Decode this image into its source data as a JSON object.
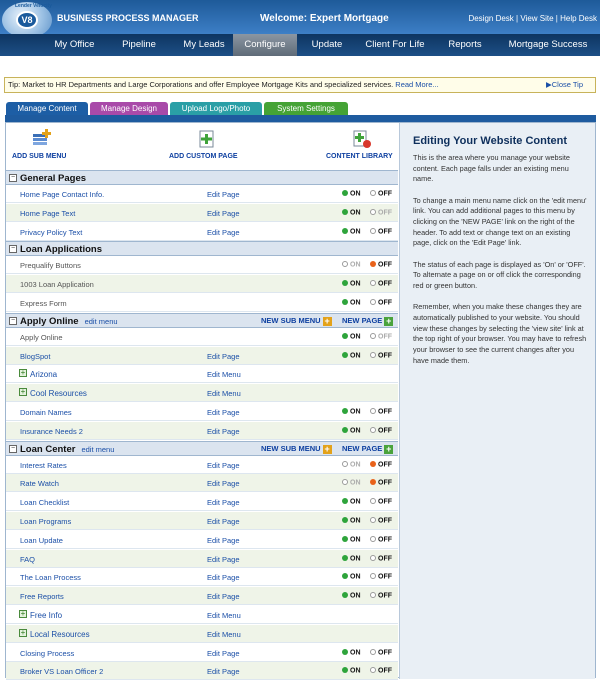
{
  "header": {
    "logo_text": "V8",
    "logo_small": "Lender Velocity",
    "app_title": "BUSINESS PROCESS MANAGER",
    "welcome": "Welcome: Expert Mortgage",
    "links": [
      "Design Desk",
      "View Site",
      "Help Desk"
    ],
    "sep": "|"
  },
  "nav": {
    "items": [
      "My Office",
      "Pipeline",
      "My Leads",
      "Configure",
      "Update",
      "Client For Life",
      "Reports",
      "Mortgage Success"
    ],
    "active": "Configure"
  },
  "tip": {
    "text": "Tip: Market to HR Departments and Large Corporations and offer Employee Mortgage Kits and specialized services.",
    "more": "Read More...",
    "close": "Close Tip",
    "close_arrow": "▶"
  },
  "tabs": [
    {
      "label": "Manage Content",
      "color": "#1d5ea5"
    },
    {
      "label": "Manage Design",
      "color": "#a94aa9"
    },
    {
      "label": "Upload Logo/Photo",
      "color": "#2a9fa6"
    },
    {
      "label": "System Settings",
      "color": "#45a335"
    }
  ],
  "toolbar": {
    "add_sub_menu": "ADD SUB MENU",
    "add_custom_page": "ADD CUSTOM PAGE",
    "content_library": "CONTENT LIBRARY"
  },
  "labels": {
    "edit_page": "Edit Page",
    "edit_menu": "Edit Menu",
    "edit_menu_header": "edit menu",
    "on": "ON",
    "off": "OFF",
    "new_sub_menu": "NEW SUB MENU",
    "new_page": "NEW PAGE",
    "minus": "−",
    "plus": "+"
  },
  "sections": [
    {
      "title": "General Pages",
      "rows": [
        {
          "name": "Home Page Contact Info.",
          "edit": "page",
          "state": "on"
        },
        {
          "name": "Home Page Text",
          "edit": "page",
          "state": "on",
          "muted_off": true
        },
        {
          "name": "Privacy Policy Text",
          "edit": "page",
          "state": "on"
        }
      ]
    },
    {
      "title": "Loan Applications",
      "rows": [
        {
          "name": "Prequalify Buttons",
          "state": "off",
          "gray": true
        },
        {
          "name": "1003 Loan Application",
          "state": "on",
          "gray": true
        },
        {
          "name": "Express Form",
          "state": "on",
          "gray": true
        }
      ]
    },
    {
      "title": "Apply Online",
      "editable": true,
      "rows": [
        {
          "name": "Apply Online",
          "state": "on",
          "gray": true,
          "muted_off": true
        },
        {
          "name": "BlogSpot",
          "edit": "page",
          "state": "on"
        },
        {
          "name": "Arizona",
          "edit": "menu",
          "sub": true
        },
        {
          "name": "Cool Resources",
          "edit": "menu",
          "sub": true
        },
        {
          "name": "Domain Names",
          "edit": "page",
          "state": "on"
        },
        {
          "name": "Insurance Needs 2",
          "edit": "page",
          "state": "on"
        }
      ]
    },
    {
      "title": "Loan Center",
      "editable": true,
      "rows": [
        {
          "name": "Interest Rates",
          "edit": "page",
          "state": "off"
        },
        {
          "name": "Rate Watch",
          "edit": "page",
          "state": "off"
        },
        {
          "name": "Loan Checklist",
          "edit": "page",
          "state": "on"
        },
        {
          "name": "Loan Programs",
          "edit": "page",
          "state": "on"
        },
        {
          "name": "Loan Update",
          "edit": "page",
          "state": "on"
        },
        {
          "name": "FAQ",
          "edit": "page",
          "state": "on"
        },
        {
          "name": "The Loan Process",
          "edit": "page",
          "state": "on"
        },
        {
          "name": "Free Reports",
          "edit": "page",
          "state": "on"
        },
        {
          "name": "Free Info",
          "edit": "menu",
          "sub": true
        },
        {
          "name": "Local Resources",
          "edit": "menu",
          "sub": true
        },
        {
          "name": "Closing Process",
          "edit": "page",
          "state": "on"
        },
        {
          "name": "Broker VS Loan Officer 2",
          "edit": "page",
          "state": "on"
        }
      ]
    }
  ],
  "help": {
    "title": "Editing Your Website Content",
    "paragraphs": [
      "This is the area where you manage your website content. Each page falls under an existing menu name.",
      "To change a main menu name click on the 'edit menu' link. You can add additional pages to this menu by clicking on the 'NEW PAGE' link on the right of the header. To add text or change text on an existing page, click on the 'Edit Page' link.",
      "The status of each page is displayed as 'On' or 'OFF'. To alternate a page on or off click the corresponding red or green button.",
      "Remember, when you make these changes they are automatically published to your website. You should view these changes by selecting the 'view site' link at the top right of your browser. You may have to refresh your browser to see the current changes after you have made them."
    ]
  }
}
